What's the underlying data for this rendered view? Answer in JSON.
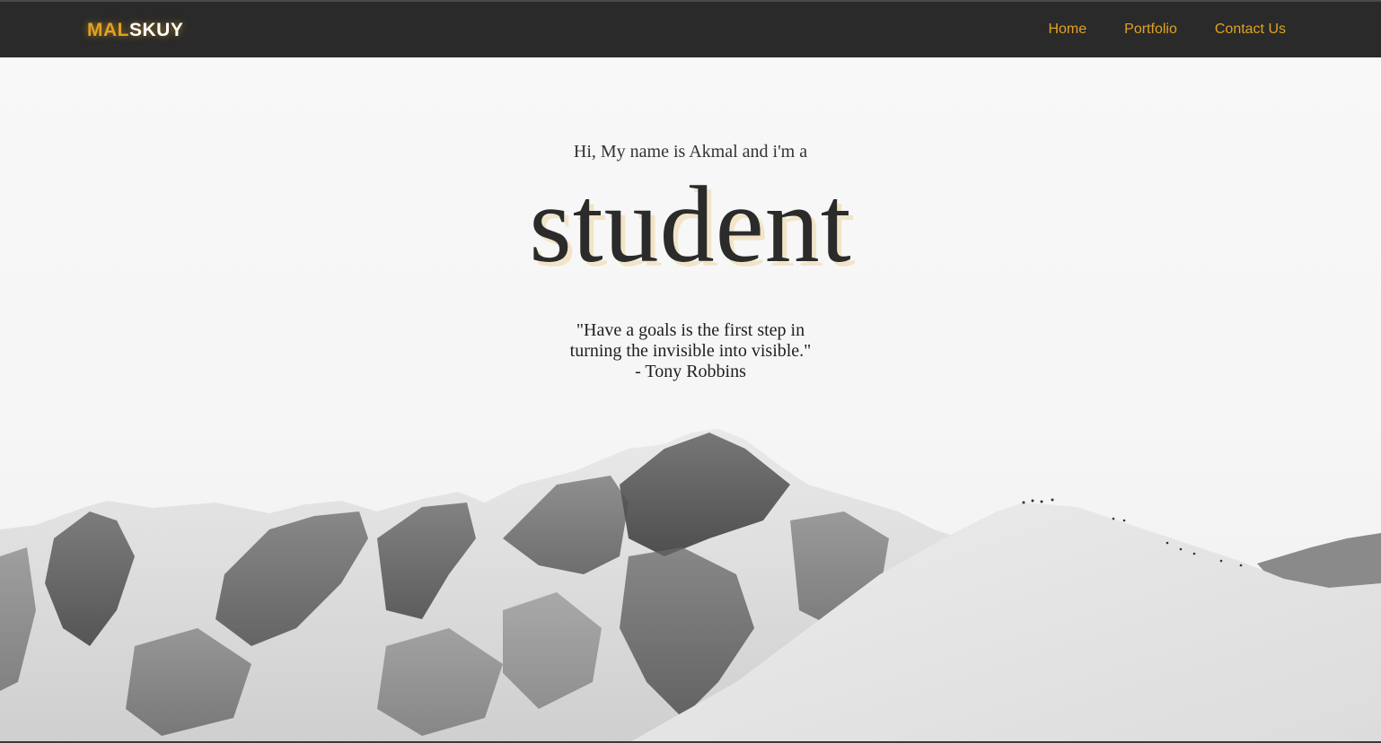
{
  "navbar": {
    "logo_part1": "MAL",
    "logo_part2": "SKUY",
    "links": [
      "Home",
      "Portfolio",
      "Contact Us"
    ]
  },
  "hero": {
    "intro": "Hi, My name is Akmal and i'm a",
    "role": "student",
    "quote_line1": "\"Have a goals is the first step in",
    "quote_line2": "turning the invisible into visible.\"",
    "quote_author": "- Tony Robbins"
  },
  "colors": {
    "accent": "#e2a21f",
    "navbar_bg": "#2a2a2a",
    "text": "#2d2d2d"
  }
}
